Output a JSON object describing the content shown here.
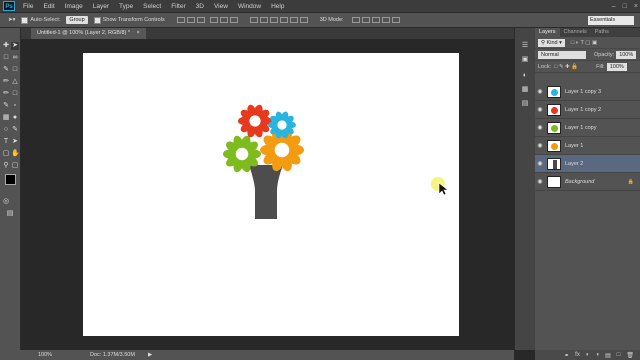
{
  "app": {
    "logo": "Ps"
  },
  "menu": [
    "File",
    "Edit",
    "Image",
    "Layer",
    "Type",
    "Select",
    "Filter",
    "3D",
    "View",
    "Window",
    "Help"
  ],
  "options": {
    "auto_select_label": "Auto-Select:",
    "auto_select_value": "Group",
    "transform_label": "Show Transform Controls",
    "mode_label": "3D Mode:",
    "workspace": "Essentials"
  },
  "document": {
    "tab_title": "Untitled-1 @ 100% (Layer 2, RGB/8) *",
    "close": "×"
  },
  "status": {
    "zoom": "100%",
    "doc_info": "Doc: 1.37M/3.50M",
    "arrow": "▶"
  },
  "layers_panel": {
    "tabs": [
      "Layers",
      "Channels",
      "Paths"
    ],
    "kind_label": "Kind",
    "blend_mode": "Normal",
    "opacity_label": "Opacity:",
    "opacity_value": "100%",
    "lock_label": "Lock:",
    "fill_label": "Fill:",
    "fill_value": "100%",
    "layers": [
      {
        "name": "Layer 1 copy 3",
        "color": "#2ab4e0",
        "selected": false
      },
      {
        "name": "Layer 1 copy 2",
        "color": "#e53a1e",
        "selected": false
      },
      {
        "name": "Layer 1 copy",
        "color": "#7dbb1e",
        "selected": false
      },
      {
        "name": "Layer 1",
        "color": "#f39c12",
        "selected": false
      },
      {
        "name": "Layer 2",
        "color": "#4a4a4a",
        "selected": true
      },
      {
        "name": "Background",
        "color": "#ffffff",
        "selected": false
      }
    ]
  },
  "flowers": [
    {
      "color": "#e53a1e",
      "name": "red-flower"
    },
    {
      "color": "#2ab4e0",
      "name": "blue-flower"
    },
    {
      "color": "#7dbb1e",
      "name": "green-flower"
    },
    {
      "color": "#f39c12",
      "name": "orange-flower"
    }
  ],
  "tree": {
    "trunk_color": "#4d4d4d"
  }
}
